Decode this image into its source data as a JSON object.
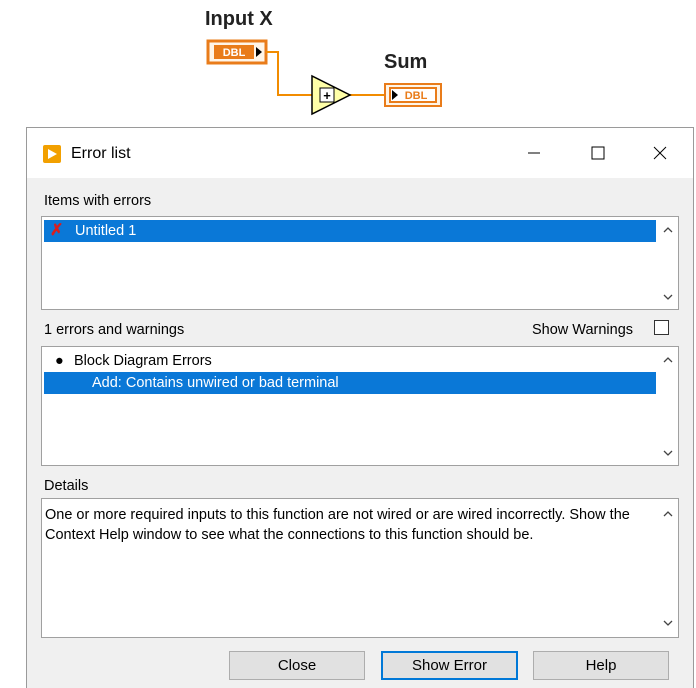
{
  "diagram": {
    "input_label": "Input X",
    "sum_label": "Sum",
    "input_type": "DBL",
    "output_type": "DBL",
    "add_symbol": "+",
    "wire_color": "#f28c00",
    "terminal_color": "#e97c1a"
  },
  "window": {
    "title": "Error list",
    "items_label": "Items with errors",
    "items": [
      {
        "icon": "error-x-icon",
        "label": "Untitled 1",
        "selected": true
      }
    ],
    "errors_count_label": "1 errors and warnings",
    "show_warnings_label": "Show Warnings",
    "show_warnings_checked": false,
    "errors": {
      "group_label": "Block Diagram Errors",
      "items": [
        {
          "label": "Add: Contains unwired or bad terminal",
          "selected": true
        }
      ]
    },
    "details_label": "Details",
    "details_text": "One or more required inputs to this function are not wired or are wired incorrectly. Show the Context Help window to see what the connections to this function should be.",
    "buttons": {
      "close": "Close",
      "show_error": "Show Error",
      "help": "Help"
    },
    "accent_color": "#0a78d7",
    "error_color": "#d81e1e"
  }
}
